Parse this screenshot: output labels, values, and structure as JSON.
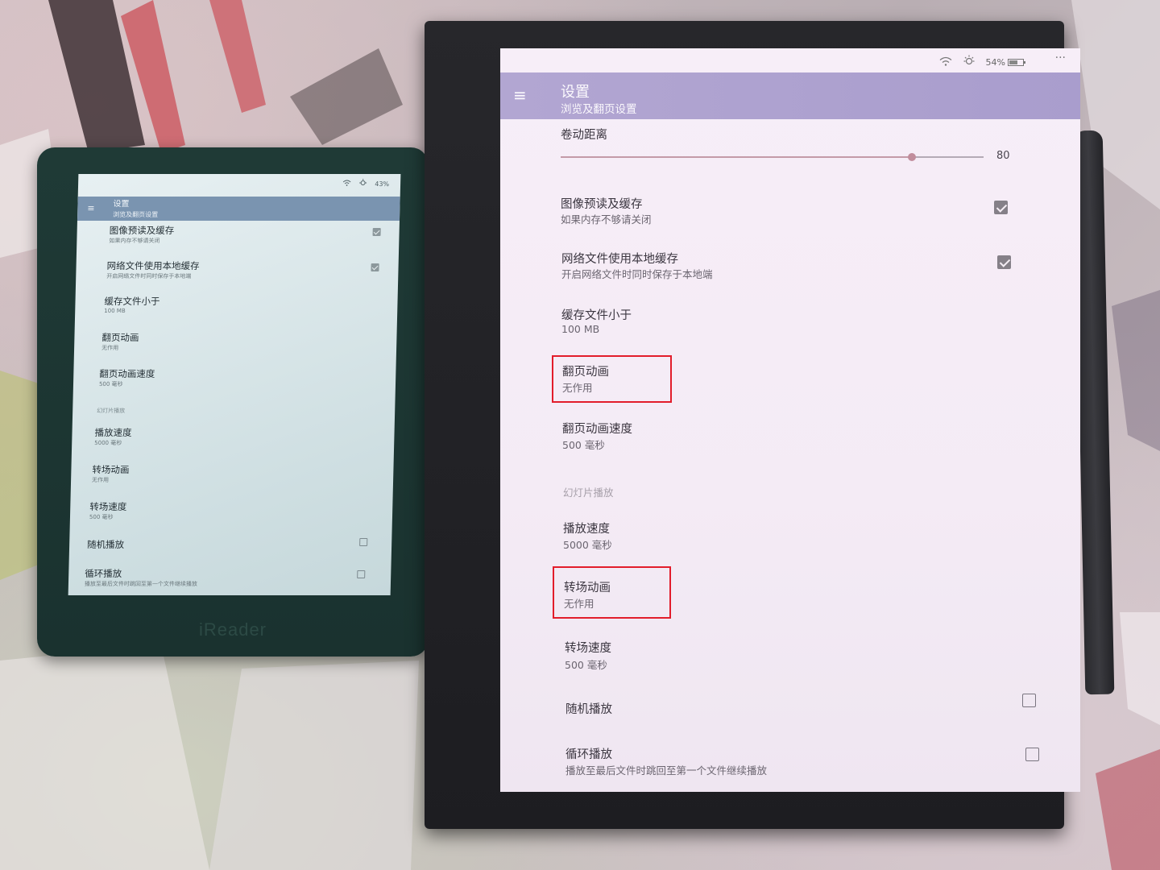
{
  "small_device": {
    "brand": "iReader",
    "status": {
      "battery": "43%"
    },
    "appbar": {
      "title": "设置",
      "subtitle": "浏览及翻页设置"
    },
    "items": [
      {
        "title": "图像预读及缓存",
        "desc": "如果内存不够请关闭",
        "checked": true
      },
      {
        "title": "网络文件使用本地缓存",
        "desc": "开启网络文件时同时保存于本地端",
        "checked": true
      },
      {
        "title": "缓存文件小于",
        "desc": "100 MB"
      },
      {
        "title": "翻页动画",
        "desc": "无作用"
      },
      {
        "title": "翻页动画速度",
        "desc": "500 毫秒"
      }
    ],
    "section": "幻灯片播放",
    "items2": [
      {
        "title": "播放速度",
        "desc": "5000 毫秒"
      },
      {
        "title": "转场动画",
        "desc": "无作用"
      },
      {
        "title": "转场速度",
        "desc": "500 毫秒"
      },
      {
        "title": "随机播放",
        "checked": false
      },
      {
        "title": "循环播放",
        "desc": "播放至最后文件时跳回至第一个文件继续播放",
        "checked": false
      }
    ]
  },
  "large_device": {
    "status": {
      "battery": "54%",
      "more": "···"
    },
    "appbar": {
      "menu": "≡",
      "title": "设置",
      "subtitle": "浏览及翻页设置"
    },
    "scroll": {
      "title": "卷动距离",
      "value": "80",
      "fraction": 0.83
    },
    "items": [
      {
        "title": "图像预读及缓存",
        "desc": "如果内存不够请关闭",
        "checked": true
      },
      {
        "title": "网络文件使用本地缓存",
        "desc": "开启网络文件时同时保存于本地端",
        "checked": true
      },
      {
        "title": "缓存文件小于",
        "desc": "100  MB"
      },
      {
        "title": "翻页动画",
        "desc": "无作用"
      },
      {
        "title": "翻页动画速度",
        "desc": "500 毫秒"
      }
    ],
    "section": "幻灯片播放",
    "items2": [
      {
        "title": "播放速度",
        "desc": "5000 毫秒"
      },
      {
        "title": "转场动画",
        "desc": "无作用"
      },
      {
        "title": "转场速度",
        "desc": "500 毫秒"
      },
      {
        "title": "随机播放",
        "checked": false
      },
      {
        "title": "循环播放",
        "desc": "播放至最后文件时跳回至第一个文件继续播放",
        "checked": false
      }
    ]
  },
  "colors": {
    "highlight": "#e21d2b",
    "large_appbar": "#aa9ecf",
    "small_appbar": "#7a94b0"
  }
}
